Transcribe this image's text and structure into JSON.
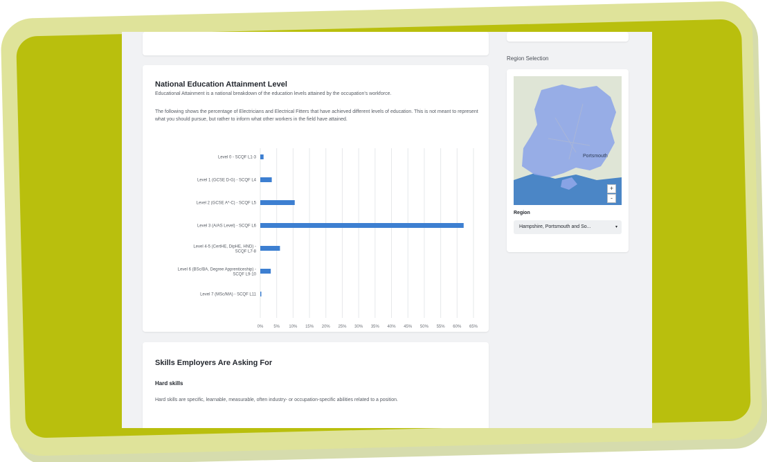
{
  "education": {
    "title": "National Education Attainment Level",
    "intro": "Educational Attainment is a national breakdown of the education levels attained by the occupation's workforce.",
    "description": "The following shows the percentage of Electricians and Electrical Fitters that have achieved different levels of education. This is not meant to represent what you should pursue, but rather to inform what other workers in the field have attained."
  },
  "chart_data": {
    "type": "bar",
    "orientation": "horizontal",
    "categories": [
      "Level 0 - SCQF L1-3",
      "Level 1 (GCSE D-G) - SCQF L4",
      "Level 2 (GCSE A*-C) - SCQF L5",
      "Level 3 (A/AS Level) - SCQF L6",
      "Level 4-5 (CertHE, DipHE, HND) - SCQF L7-8",
      "Level 6 (BSc/BA, Degree Apprenticeship) - SCQF L9-10",
      "Level 7 (MSc/MA) - SCQF L11"
    ],
    "values": [
      1,
      3.5,
      10.5,
      62,
      6,
      3.2,
      0.2
    ],
    "xlim": [
      0,
      65
    ],
    "xticks": [
      "0%",
      "5%",
      "10%",
      "15%",
      "20%",
      "25%",
      "30%",
      "35%",
      "40%",
      "45%",
      "50%",
      "55%",
      "60%",
      "65%"
    ],
    "grid": true,
    "bar_color": "#3d7fd1"
  },
  "skills": {
    "title": "Skills Employers Are Asking For",
    "hard_title": "Hard skills",
    "hard_desc": "Hard skills are specific, learnable, measurable, often industry- or occupation-specific abilities related to a position."
  },
  "sidebar": {
    "region_title": "Region Selection",
    "map_town": "Portsmouth",
    "zoom_in": "+",
    "zoom_out": "-",
    "region_label": "Region",
    "region_value": "Hampshire, Portsmouth and So...",
    "caret": "▾"
  },
  "colors": {
    "frame": "#b9bf0d",
    "frame_border": "#dfe39a",
    "map_region": "#8fa6e8",
    "map_sea": "#4b86c6"
  }
}
